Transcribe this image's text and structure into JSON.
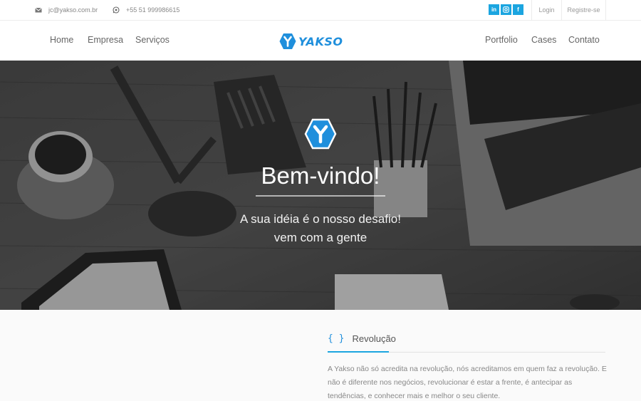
{
  "topbar": {
    "email": "jc@yakso.com.br",
    "phone": "+55 51 999986615",
    "social": [
      "in",
      "ig",
      "f"
    ],
    "login": "Login",
    "register": "Registre-se"
  },
  "nav": {
    "left": [
      "Home",
      "Empresa",
      "Serviços"
    ],
    "right": [
      "Portfolio",
      "Cases",
      "Contato"
    ],
    "logo_text": "YAKSO"
  },
  "hero": {
    "title": "Bem-vindo!",
    "subtitle_line1": "A sua idéia é o nosso desafio!",
    "subtitle_line2": "vem com a gente"
  },
  "section": {
    "icon": "{ }",
    "title": "Revolução",
    "body": "A Yakso não só acredita na revolução, nós acreditamos em quem faz a revolução. E não é diferente nos negócios, revolucionar é estar a frente, é antecipar as tendências, e conhecer mais e melhor o seu cliente."
  },
  "colors": {
    "accent": "#1ba5e0",
    "logo": "#1f8fdc"
  }
}
